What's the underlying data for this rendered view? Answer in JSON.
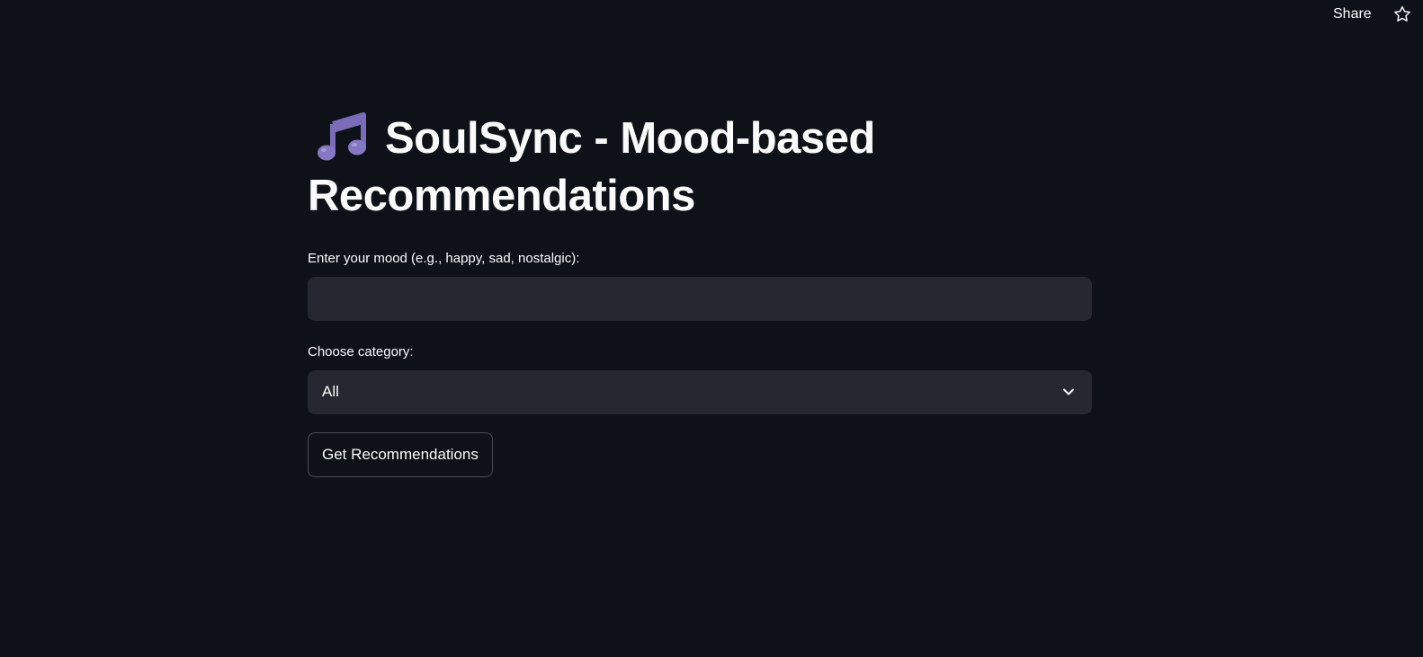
{
  "header": {
    "share_label": "Share",
    "star_icon": "star-icon"
  },
  "main": {
    "title_icon": "musical-notes-icon",
    "title": "SoulSync - Mood-based Recommendations",
    "mood_label": "Enter your mood (e.g., happy, sad, nostalgic):",
    "mood_value": "",
    "category_label": "Choose category:",
    "category_selected": "All",
    "button_label": "Get Recommendations"
  },
  "colors": {
    "background": "#0e1117",
    "input_background": "#262730",
    "text": "#fafafa",
    "icon_purple": "#7a6cb8"
  }
}
